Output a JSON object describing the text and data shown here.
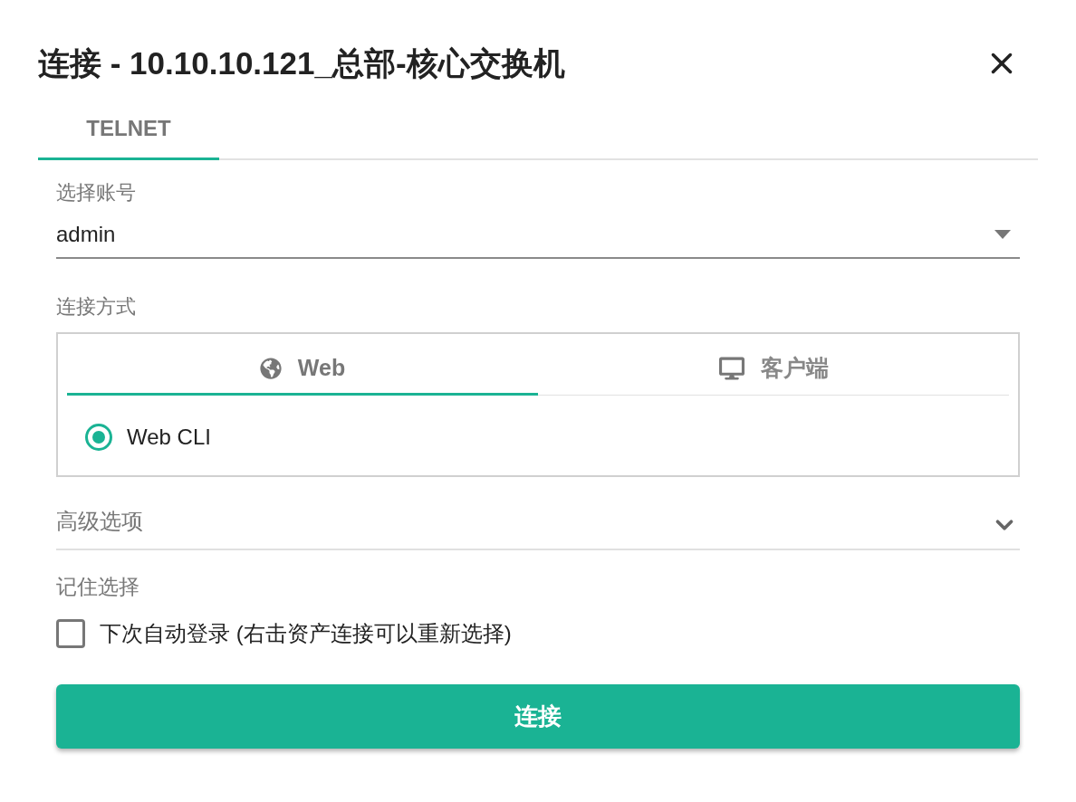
{
  "dialog": {
    "title": "连接 - 10.10.10.121_总部-核心交换机"
  },
  "tabs": [
    {
      "label": "TELNET",
      "selected": true
    }
  ],
  "account": {
    "label": "选择账号",
    "value": "admin"
  },
  "connection_method": {
    "label": "连接方式",
    "tabs": [
      {
        "kind": "web",
        "label": "Web",
        "selected": true
      },
      {
        "kind": "client",
        "label": "客户端",
        "selected": false
      }
    ],
    "options": [
      {
        "label": "Web CLI",
        "selected": true
      }
    ]
  },
  "advanced": {
    "label": "高级选项",
    "expanded": false
  },
  "remember": {
    "label": "记住选择",
    "checkbox": {
      "label": "下次自动登录 (右击资产连接可以重新选择)",
      "checked": false
    }
  },
  "submit": {
    "label": "连接"
  }
}
